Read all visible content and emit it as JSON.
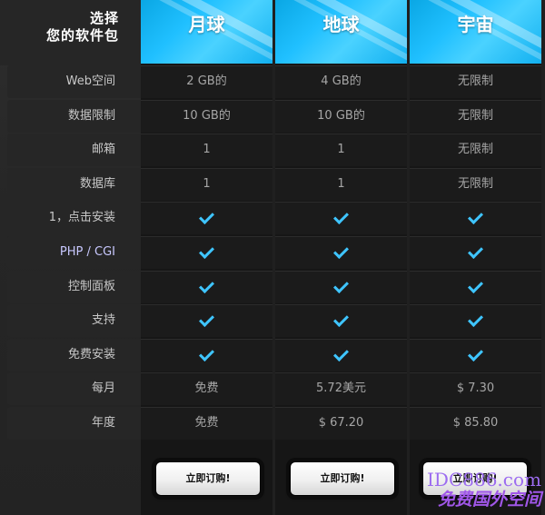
{
  "header": {
    "title_line1": "选择",
    "title_line2": "您的软件包",
    "plans": [
      "月球",
      "地球",
      "宇宙"
    ]
  },
  "features": [
    {
      "label": "Web空间",
      "values": [
        "2 GB的",
        "4 GB的",
        "无限制"
      ]
    },
    {
      "label": "数据限制",
      "values": [
        "10 GB的",
        "10 GB的",
        "无限制"
      ]
    },
    {
      "label": "邮箱",
      "values": [
        "1",
        "1",
        "无限制"
      ]
    },
    {
      "label": "数据库",
      "values": [
        "1",
        "1",
        "无限制"
      ]
    },
    {
      "label": "1，点击安装",
      "values": [
        "check",
        "check",
        "check"
      ]
    },
    {
      "label": "PHP / CGI",
      "values": [
        "check",
        "check",
        "check"
      ]
    },
    {
      "label": "控制面板",
      "values": [
        "check",
        "check",
        "check"
      ]
    },
    {
      "label": "支持",
      "values": [
        "check",
        "check",
        "check"
      ]
    },
    {
      "label": "免费安装",
      "values": [
        "check",
        "check",
        "check"
      ]
    },
    {
      "label": "每月",
      "values": [
        "免费",
        "5.72美元",
        "$ 7.30"
      ]
    },
    {
      "label": "年度",
      "values": [
        "免费",
        "$ 67.20",
        "$ 85.80"
      ]
    }
  ],
  "buttons": {
    "order_label": "立即订购!"
  },
  "watermark": {
    "line1": "IDC886.com",
    "line2": "免费国外空间"
  },
  "colors": {
    "header_blue": "#20c0ff",
    "check": "#3fc5ff"
  }
}
